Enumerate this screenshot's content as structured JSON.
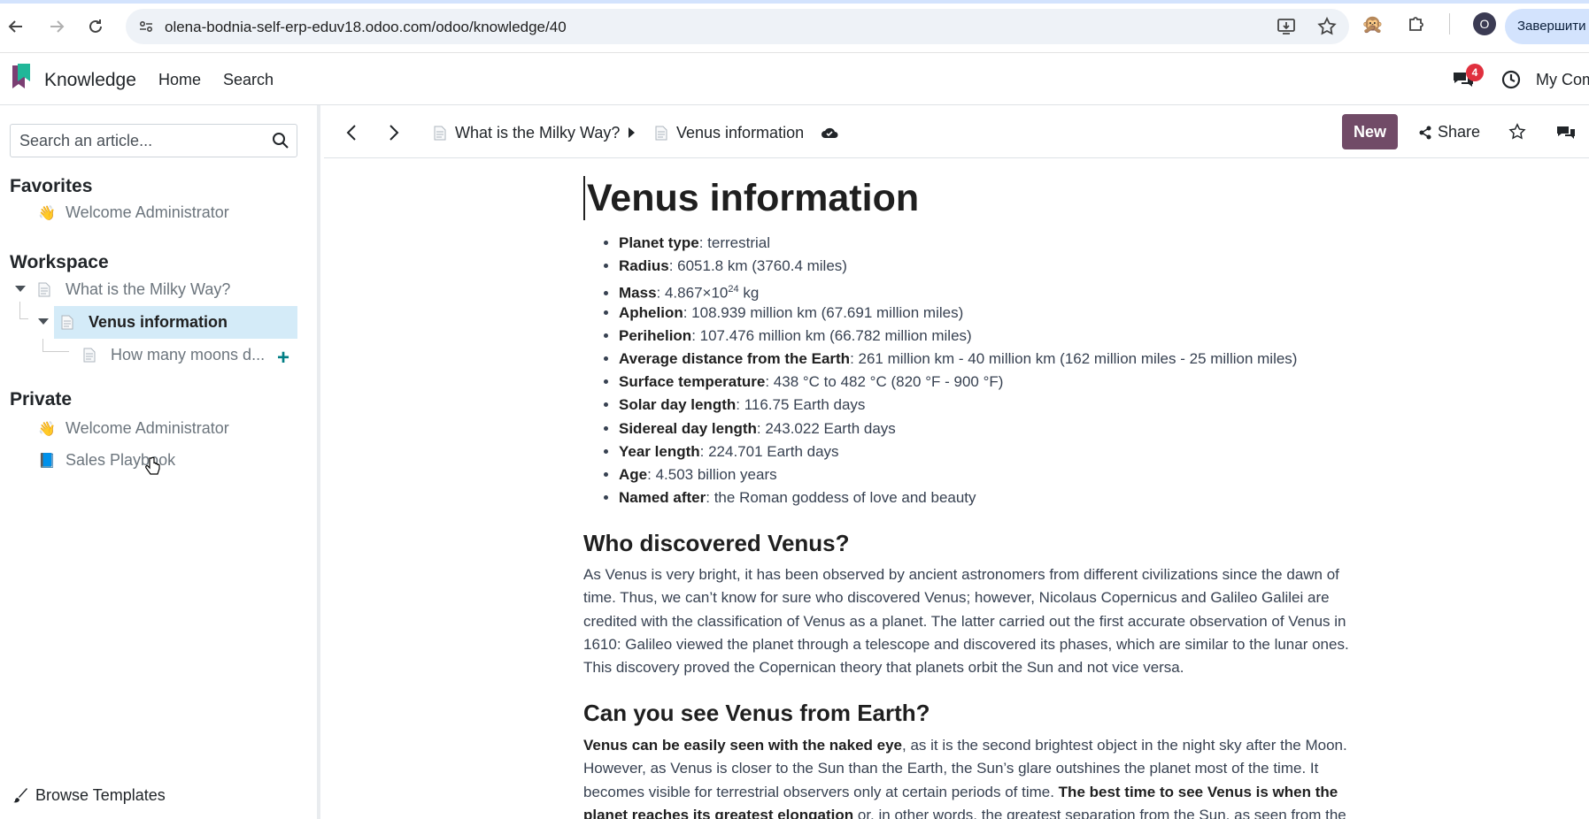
{
  "browser": {
    "url": "olena-bodnia-self-erp-eduv18.odoo.com/odoo/knowledge/40",
    "profile_initial": "O",
    "finish_label": "Завершити"
  },
  "app": {
    "name": "Knowledge",
    "menu_home": "Home",
    "menu_search": "Search",
    "chat_badge": "4",
    "company": "My Company"
  },
  "sidebar": {
    "search_placeholder": "Search an article...",
    "favorites_title": "Favorites",
    "favorites": [
      {
        "icon": "👋",
        "label": "Welcome Administrator"
      }
    ],
    "workspace_title": "Workspace",
    "workspace": [
      {
        "label": "What is the Milky Way?"
      },
      {
        "label": "Venus information"
      },
      {
        "label": "How many moons d..."
      }
    ],
    "private_title": "Private",
    "private": [
      {
        "icon": "👋",
        "label": "Welcome Administrator"
      },
      {
        "icon": "📘",
        "label": "Sales Playbook"
      }
    ],
    "browse_templates": "Browse Templates"
  },
  "control": {
    "crumb_parent": "What is the Milky Way?",
    "crumb_current": "Venus information",
    "new_label": "New",
    "share_label": "Share"
  },
  "article": {
    "title": "Venus information",
    "facts": [
      {
        "k": "Planet type",
        "v": ": terrestrial"
      },
      {
        "k": "Radius",
        "v": ": 6051.8 km (3760.4 miles)"
      },
      {
        "k": "Mass",
        "v": ": 4.867×10",
        "sup": "24",
        "v2": " kg"
      },
      {
        "k": "Aphelion",
        "v": ": 108.939 million km (67.691 million miles)"
      },
      {
        "k": "Perihelion",
        "v": ": 107.476 million km (66.782 million miles)"
      },
      {
        "k": "Average distance from the Earth",
        "v": ": 261 million km - 40 million km (162 million miles - 25 million miles)"
      },
      {
        "k": "Surface temperature",
        "v": ": 438 °C to 482 °C (820 °F - 900 °F)"
      },
      {
        "k": "Solar day length",
        "v": ": 116.75 Earth days"
      },
      {
        "k": "Sidereal day length",
        "v": ": 243.022 Earth days"
      },
      {
        "k": "Year length",
        "v": ": 224.701 Earth days"
      },
      {
        "k": "Age",
        "v": ": 4.503 billion years"
      },
      {
        "k": "Named after",
        "v": ": the Roman goddess of love and beauty"
      }
    ],
    "h2_discovered": "Who discovered Venus?",
    "p_discovered": "As Venus is very bright, it has been observed by ancient astronomers from different civilizations since the dawn of time. Thus, we can’t know for sure who discovered Venus; however, Nicolaus Copernicus and Galileo Galilei are credited with the classification of Venus as a planet. The latter carried out the first accurate observation of Venus in 1610: Galileo viewed the planet through a telescope and discovered its phases, which are similar to the lunar ones. This discovery proved the Copernican theory that planets orbit the Sun and not vice versa.",
    "h2_see": "Can you see Venus from Earth?",
    "p_see_b1": "Venus can be easily seen with the naked eye",
    "p_see_t1": ", as it is the second brightest object in the night sky after the Moon. However, as Venus is closer to the Sun than the Earth, the Sun’s glare outshines the planet most of the time. It becomes visible for terrestrial observers only at certain periods of time. ",
    "p_see_b2": "The best time to see Venus is when the planet reaches its greatest elongation",
    "p_see_t2": " or, in other words, the greatest separation from the Sun, as seen from the"
  }
}
